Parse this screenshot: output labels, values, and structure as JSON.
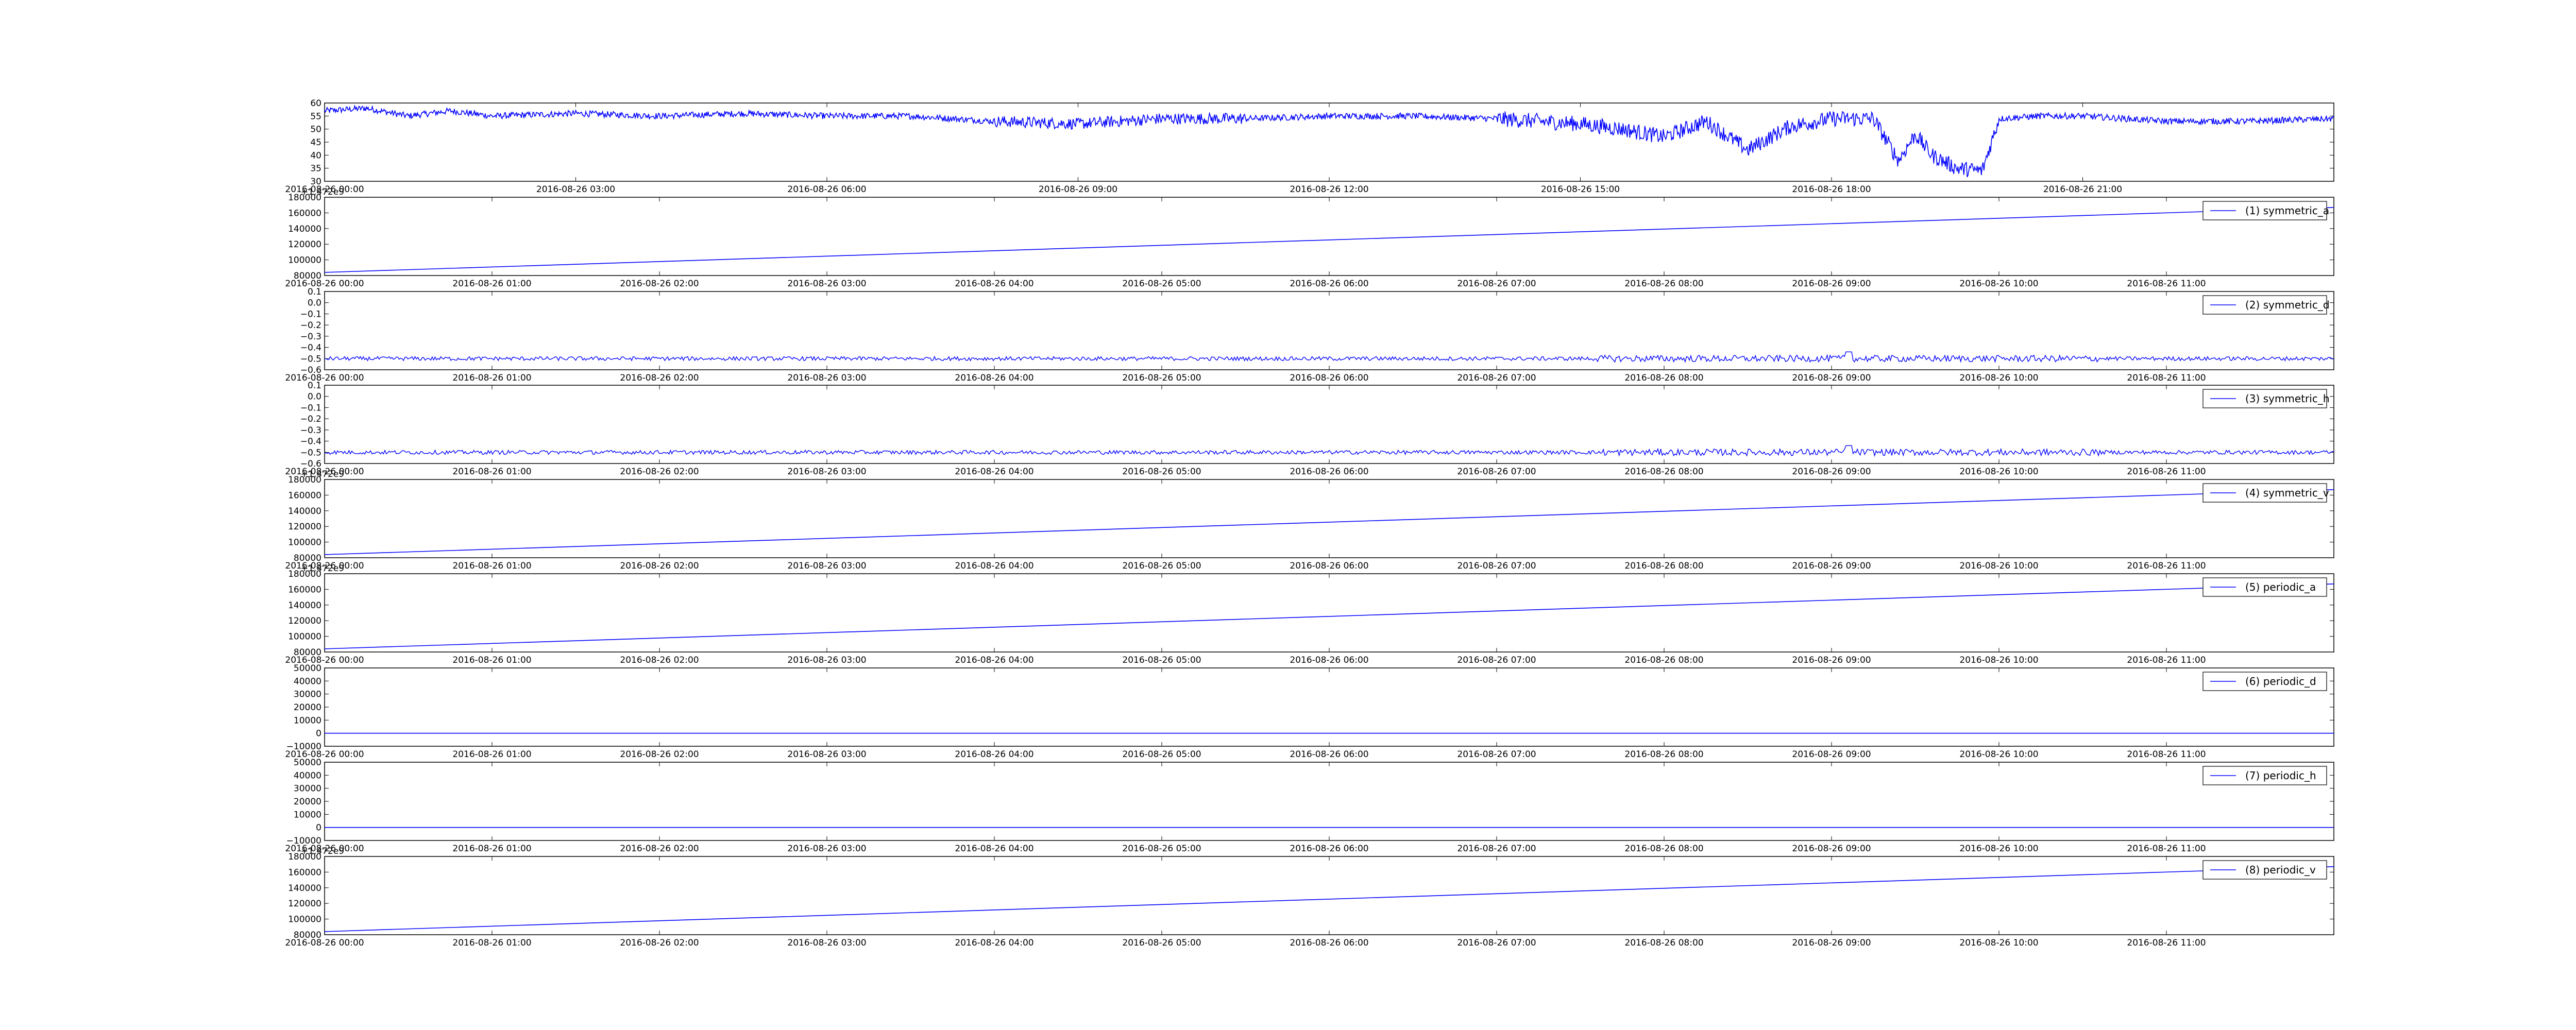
{
  "chart_data": [
    {
      "type": "line",
      "line_color": "#0000ff",
      "x_range": [
        "2016-08-26 00:00",
        "2016-08-27 00:00"
      ],
      "x_ticks": [
        "2016-08-26 00:00",
        "2016-08-26 03:00",
        "2016-08-26 06:00",
        "2016-08-26 09:00",
        "2016-08-26 12:00",
        "2016-08-26 15:00",
        "2016-08-26 18:00",
        "2016-08-26 21:00"
      ],
      "ylim": [
        30,
        60
      ],
      "y_ticks": [
        "30",
        "35",
        "40",
        "45",
        "50",
        "55",
        "60"
      ],
      "series": [
        {
          "x_hours": [
            0,
            0.5,
            1,
            1.5,
            2,
            3,
            4,
            5,
            6,
            7,
            8,
            9,
            10,
            11,
            12,
            13,
            14,
            14.5,
            15,
            15.5,
            16,
            16.5,
            17,
            17.5,
            18,
            18.5,
            18.8,
            19,
            19.2,
            19.5,
            19.8,
            20,
            20.5,
            21,
            22,
            23,
            24
          ],
          "values": [
            57,
            58,
            55,
            57,
            55,
            56,
            55,
            56,
            55,
            55,
            53,
            52,
            54,
            54,
            55,
            55,
            54,
            53,
            52,
            50,
            47,
            53,
            42,
            51,
            54,
            54,
            38,
            48,
            40,
            35,
            34,
            54,
            55,
            55,
            53,
            53,
            54
          ]
        }
      ]
    },
    {
      "type": "line",
      "line_color": "#0000ff",
      "offset_label": "+1.472e9",
      "x_range": [
        "2016-08-26 00:00",
        "2016-08-26 12:00"
      ],
      "x_ticks": [
        "2016-08-26 00:00",
        "2016-08-26 01:00",
        "2016-08-26 02:00",
        "2016-08-26 03:00",
        "2016-08-26 04:00",
        "2016-08-26 05:00",
        "2016-08-26 06:00",
        "2016-08-26 07:00",
        "2016-08-26 08:00",
        "2016-08-26 09:00",
        "2016-08-26 10:00",
        "2016-08-26 11:00"
      ],
      "ylim": [
        80000,
        180000
      ],
      "y_ticks": [
        "80000",
        "100000",
        "120000",
        "140000",
        "160000",
        "180000"
      ],
      "series": [
        {
          "name": "(1) symmetric_a",
          "x_hours": [
            0,
            12
          ],
          "values": [
            84000,
            167000
          ]
        }
      ]
    },
    {
      "type": "line",
      "line_color": "#0000ff",
      "noise": true,
      "x_range": [
        "2016-08-26 00:00",
        "2016-08-26 12:00"
      ],
      "x_ticks": [
        "2016-08-26 00:00",
        "2016-08-26 01:00",
        "2016-08-26 02:00",
        "2016-08-26 03:00",
        "2016-08-26 04:00",
        "2016-08-26 05:00",
        "2016-08-26 06:00",
        "2016-08-26 07:00",
        "2016-08-26 08:00",
        "2016-08-26 09:00",
        "2016-08-26 10:00",
        "2016-08-26 11:00"
      ],
      "ylim": [
        -0.6,
        0.1
      ],
      "y_ticks": [
        "−0.6",
        "−0.5",
        "−0.4",
        "−0.3",
        "−0.2",
        "−0.1",
        "0.0",
        "0.1"
      ],
      "series": [
        {
          "name": "(2) symmetric_d",
          "values": [
            -0.5
          ]
        }
      ]
    },
    {
      "type": "line",
      "line_color": "#0000ff",
      "noise": true,
      "x_range": [
        "2016-08-26 00:00",
        "2016-08-26 12:00"
      ],
      "x_ticks": [
        "2016-08-26 00:00",
        "2016-08-26 01:00",
        "2016-08-26 02:00",
        "2016-08-26 03:00",
        "2016-08-26 04:00",
        "2016-08-26 05:00",
        "2016-08-26 06:00",
        "2016-08-26 07:00",
        "2016-08-26 08:00",
        "2016-08-26 09:00",
        "2016-08-26 10:00",
        "2016-08-26 11:00"
      ],
      "ylim": [
        -0.6,
        0.1
      ],
      "y_ticks": [
        "−0.6",
        "−0.5",
        "−0.4",
        "−0.3",
        "−0.2",
        "−0.1",
        "0.0",
        "0.1"
      ],
      "series": [
        {
          "name": "(3) symmetric_h",
          "values": [
            -0.5
          ]
        }
      ]
    },
    {
      "type": "line",
      "line_color": "#0000ff",
      "offset_label": "+1.472e9",
      "x_range": [
        "2016-08-26 00:00",
        "2016-08-26 12:00"
      ],
      "x_ticks": [
        "2016-08-26 00:00",
        "2016-08-26 01:00",
        "2016-08-26 02:00",
        "2016-08-26 03:00",
        "2016-08-26 04:00",
        "2016-08-26 05:00",
        "2016-08-26 06:00",
        "2016-08-26 07:00",
        "2016-08-26 08:00",
        "2016-08-26 09:00",
        "2016-08-26 10:00",
        "2016-08-26 11:00"
      ],
      "ylim": [
        80000,
        180000
      ],
      "y_ticks": [
        "80000",
        "100000",
        "120000",
        "140000",
        "160000",
        "180000"
      ],
      "series": [
        {
          "name": "(4) symmetric_v",
          "x_hours": [
            0,
            12
          ],
          "values": [
            84000,
            167000
          ]
        }
      ]
    },
    {
      "type": "line",
      "line_color": "#0000ff",
      "offset_label": "+1.472e9",
      "x_range": [
        "2016-08-26 00:00",
        "2016-08-26 12:00"
      ],
      "x_ticks": [
        "2016-08-26 00:00",
        "2016-08-26 01:00",
        "2016-08-26 02:00",
        "2016-08-26 03:00",
        "2016-08-26 04:00",
        "2016-08-26 05:00",
        "2016-08-26 06:00",
        "2016-08-26 07:00",
        "2016-08-26 08:00",
        "2016-08-26 09:00",
        "2016-08-26 10:00",
        "2016-08-26 11:00"
      ],
      "ylim": [
        80000,
        180000
      ],
      "y_ticks": [
        "80000",
        "100000",
        "120000",
        "140000",
        "160000",
        "180000"
      ],
      "series": [
        {
          "name": "(5) periodic_a",
          "x_hours": [
            0,
            12
          ],
          "values": [
            84000,
            167000
          ]
        }
      ]
    },
    {
      "type": "line",
      "line_color": "#0000ff",
      "x_range": [
        "2016-08-26 00:00",
        "2016-08-26 12:00"
      ],
      "x_ticks": [
        "2016-08-26 00:00",
        "2016-08-26 01:00",
        "2016-08-26 02:00",
        "2016-08-26 03:00",
        "2016-08-26 04:00",
        "2016-08-26 05:00",
        "2016-08-26 06:00",
        "2016-08-26 07:00",
        "2016-08-26 08:00",
        "2016-08-26 09:00",
        "2016-08-26 10:00",
        "2016-08-26 11:00"
      ],
      "ylim": [
        -10000,
        50000
      ],
      "y_ticks": [
        "−10000",
        "0",
        "10000",
        "20000",
        "30000",
        "40000",
        "50000"
      ],
      "series": [
        {
          "name": "(6) periodic_d",
          "x_hours": [
            0,
            12
          ],
          "values": [
            0,
            0
          ]
        }
      ]
    },
    {
      "type": "line",
      "line_color": "#0000ff",
      "x_range": [
        "2016-08-26 00:00",
        "2016-08-26 12:00"
      ],
      "x_ticks": [
        "2016-08-26 00:00",
        "2016-08-26 01:00",
        "2016-08-26 02:00",
        "2016-08-26 03:00",
        "2016-08-26 04:00",
        "2016-08-26 05:00",
        "2016-08-26 06:00",
        "2016-08-26 07:00",
        "2016-08-26 08:00",
        "2016-08-26 09:00",
        "2016-08-26 10:00",
        "2016-08-26 11:00"
      ],
      "ylim": [
        -10000,
        50000
      ],
      "y_ticks": [
        "−10000",
        "0",
        "10000",
        "20000",
        "30000",
        "40000",
        "50000"
      ],
      "series": [
        {
          "name": "(7) periodic_h",
          "x_hours": [
            0,
            12
          ],
          "values": [
            0,
            0
          ]
        }
      ]
    },
    {
      "type": "line",
      "line_color": "#0000ff",
      "offset_label": "+1.472e9",
      "x_range": [
        "2016-08-26 00:00",
        "2016-08-26 12:00"
      ],
      "x_ticks": [
        "2016-08-26 00:00",
        "2016-08-26 01:00",
        "2016-08-26 02:00",
        "2016-08-26 03:00",
        "2016-08-26 04:00",
        "2016-08-26 05:00",
        "2016-08-26 06:00",
        "2016-08-26 07:00",
        "2016-08-26 08:00",
        "2016-08-26 09:00",
        "2016-08-26 10:00",
        "2016-08-26 11:00"
      ],
      "ylim": [
        80000,
        180000
      ],
      "y_ticks": [
        "80000",
        "100000",
        "120000",
        "140000",
        "160000",
        "180000"
      ],
      "series": [
        {
          "name": "(8) periodic_v",
          "x_hours": [
            0,
            12
          ],
          "values": [
            84000,
            167000
          ]
        }
      ]
    }
  ]
}
